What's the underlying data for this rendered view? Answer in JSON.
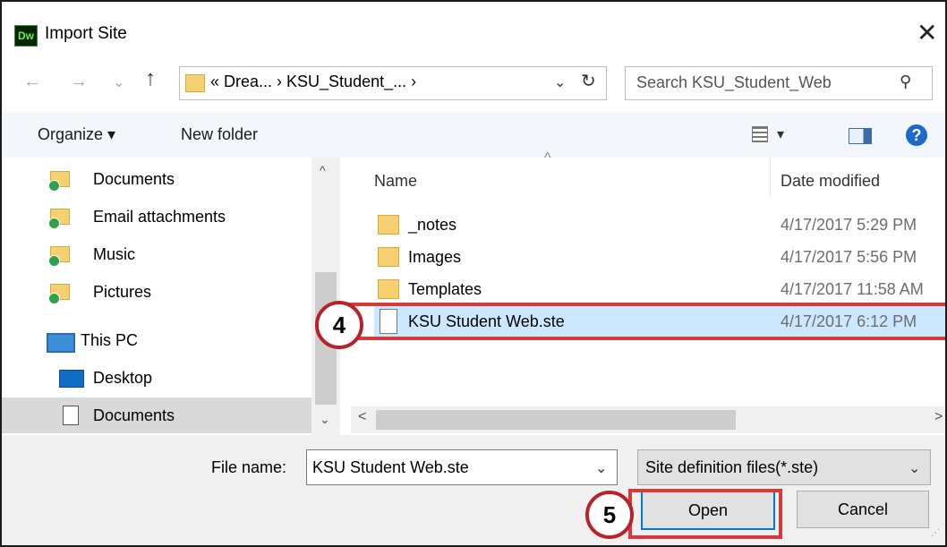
{
  "window": {
    "title": "Import Site",
    "app_logo": "Dw",
    "close_icon": "✕"
  },
  "nav": {
    "back": "←",
    "forward": "→",
    "recent": "⌄",
    "up": "↑",
    "breadcrumb": "«  Drea...  ›  KSU_Student_...  ›",
    "address_dropdown": "⌄",
    "refresh": "↻",
    "search_placeholder": "Search KSU_Student_Web",
    "search_icon": "⚲"
  },
  "toolbar": {
    "organize": "Organize ▾",
    "new_folder": "New folder",
    "view_arrow": "▾",
    "help": "?"
  },
  "sidebar": {
    "items": [
      {
        "label": "Documents",
        "icon": "folder-sync-icon"
      },
      {
        "label": "Email attachments",
        "icon": "folder-sync-icon"
      },
      {
        "label": "Music",
        "icon": "folder-sync-icon"
      },
      {
        "label": "Pictures",
        "icon": "folder-sync-icon"
      },
      {
        "label": "This PC",
        "icon": "pc-icon"
      },
      {
        "label": "Desktop",
        "icon": "desktop-icon"
      },
      {
        "label": "Documents",
        "icon": "document-icon",
        "selected": true
      }
    ],
    "scroll_up": "^",
    "scroll_down": "⌄"
  },
  "files": {
    "columns": {
      "name": "Name",
      "date": "Date modified"
    },
    "sort_indicator": "^",
    "rows": [
      {
        "name": "_notes",
        "date": "4/17/2017 5:29 PM",
        "type": "folder"
      },
      {
        "name": "Images",
        "date": "4/17/2017 5:56 PM",
        "type": "folder"
      },
      {
        "name": "Templates",
        "date": "4/17/2017 11:58 AM",
        "type": "folder"
      },
      {
        "name": "KSU Student Web.ste",
        "date": "4/17/2017 6:12 PM",
        "type": "file",
        "selected": true
      }
    ],
    "hscroll_left": "<",
    "hscroll_right": ">"
  },
  "annotations": {
    "step4": "4",
    "step5": "5",
    "color": "#d63b3b"
  },
  "bottom": {
    "file_name_label": "File name:",
    "file_name_value": "KSU Student Web.ste",
    "file_name_dropdown": "⌄",
    "file_type_value": "Site definition files(*.ste)",
    "file_type_dropdown": "⌄",
    "open_label": "Open",
    "cancel_label": "Cancel"
  },
  "colors": {
    "accent": "#0078d7",
    "selection": "#cce8ff",
    "toolbar": "#f3f6fb",
    "folder": "#f6d172"
  }
}
